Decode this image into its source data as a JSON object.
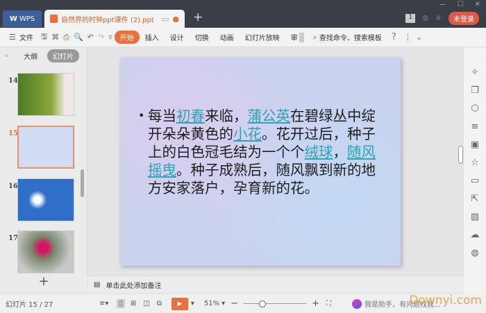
{
  "titlebar": {
    "wps_tab": "WPS",
    "doc_tab": "自然界的时钟ppt课件 (2).ppt",
    "badge": "1",
    "login": "未登录"
  },
  "toolbar": {
    "file": "文件",
    "tabs": [
      "开始",
      "插入",
      "设计",
      "切换",
      "动画",
      "幻灯片放映",
      "审"
    ],
    "search": "查找命令、搜索模板",
    "help": "?"
  },
  "left_panel": {
    "outline_tab": "大纲",
    "slides_tab": "幻灯片",
    "thumbnails": [
      {
        "num": "14"
      },
      {
        "num": "15",
        "selected": true
      },
      {
        "num": "16"
      },
      {
        "num": "17"
      }
    ]
  },
  "slide": {
    "segments": [
      {
        "t": "每当",
        "link": false
      },
      {
        "t": "初春",
        "link": true
      },
      {
        "t": "来临，",
        "link": false
      },
      {
        "t": "蒲公英",
        "link": true
      },
      {
        "t": "在碧绿丛中绽开朵朵黄色的",
        "link": false
      },
      {
        "t": "小花",
        "link": true
      },
      {
        "t": "。花开过后，种子上的白色冠毛结为一个个",
        "link": false
      },
      {
        "t": "绒球",
        "link": true
      },
      {
        "t": "，",
        "link": false
      },
      {
        "t": "随风摇曳",
        "link": true
      },
      {
        "t": "。种子成熟后，随风飘到新的地方安家落户，孕育新的花。",
        "link": false
      }
    ]
  },
  "notes": {
    "placeholder": "单击此处添加备注"
  },
  "status": {
    "slide_counter": "幻灯片 15 / 27",
    "zoom": "51%",
    "assistant": "我是助手，有问题找我..."
  },
  "watermark": "Downyi.com",
  "colors": {
    "accent": "#e8703a",
    "link": "#2aa3b4"
  }
}
